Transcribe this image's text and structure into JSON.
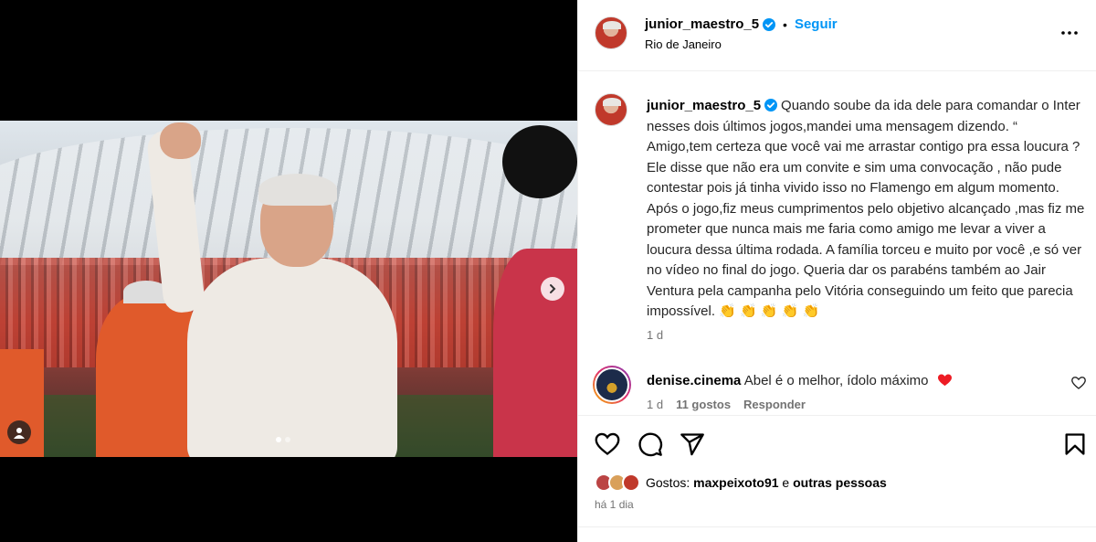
{
  "post": {
    "username": "junior_maestro_5",
    "follow_label": "Seguir",
    "bullet": "•",
    "location": "Rio de Janeiro",
    "caption": "Quando soube da ida dele para comandar o Inter nesses dois últimos jogos,mandei uma mensagem dizendo. “ Amigo,tem certeza que você vai me arrastar contigo pra essa loucura ? Ele disse que não era um convite e sim uma convocação , não pude contestar pois já tinha vivido isso no Flamengo em algum momento. Após o jogo,fiz meus cumprimentos pelo objetivo alcançado ,mas fiz me prometer que nunca mais me faria como amigo me levar a viver a loucura dessa última rodada. A família torceu e muito por você ,e só ver no vídeo no final do jogo. Queria dar os parabéns também ao Jair Ventura pela campanha pelo Vitória conseguindo um feito que parecia impossível. 👏 👏 👏 👏 👏",
    "caption_time": "1 d",
    "carousel": {
      "slides": 2,
      "current": 1
    }
  },
  "comment": {
    "username": "denise.cinema",
    "text": "Abel é o melhor, ídolo máximo",
    "time": "1 d",
    "likes": "11 gostos",
    "reply_label": "Responder"
  },
  "likes": {
    "prefix": "Gostos:",
    "first_user": "maxpeixoto91",
    "joiner": "e",
    "others": "outras pessoas"
  },
  "posted_ago": "há 1 dia",
  "colors": {
    "accent": "#0095f6",
    "verified": "#0095f6",
    "heart": "#ed1c24",
    "muted": "#737373"
  },
  "icons": [
    "verified-badge-icon",
    "more-options-icon",
    "heart-icon",
    "comment-icon",
    "share-icon",
    "bookmark-icon",
    "carousel-next-icon",
    "tagged-user-icon"
  ]
}
